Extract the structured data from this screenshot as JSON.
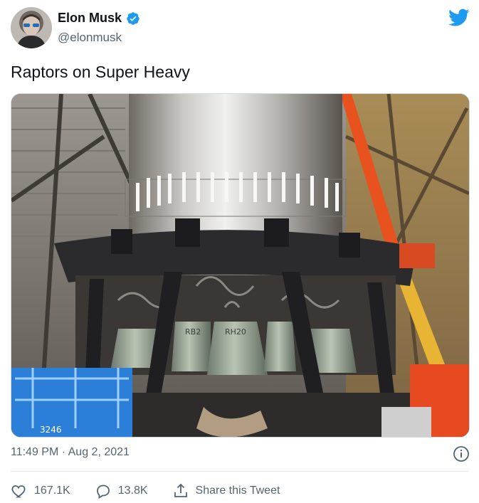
{
  "user": {
    "display_name": "Elon Musk",
    "handle": "@elonmusk",
    "verified": true
  },
  "tweet": {
    "text": "Raptors on Super Heavy",
    "timestamp": "11:49 PM · Aug 2, 2021",
    "media_description": "Photo of SpaceX Super Heavy booster with Raptor engines inside the high bay",
    "image_text": {
      "engine_label_1": "RB2",
      "engine_label_2": "RH20",
      "lift_label": "3246"
    }
  },
  "actions": {
    "like_count": "167.1K",
    "reply_count": "13.8K",
    "share_label": "Share this Tweet"
  },
  "colors": {
    "twitter_blue": "#1d9bf0",
    "secondary_text": "#536471",
    "primary_text": "#0f1419"
  },
  "icons": {
    "brand": "twitter-bird-icon",
    "verified": "verified-badge-icon",
    "info": "info-icon",
    "like": "heart-icon",
    "reply": "comment-icon",
    "share": "share-icon"
  }
}
